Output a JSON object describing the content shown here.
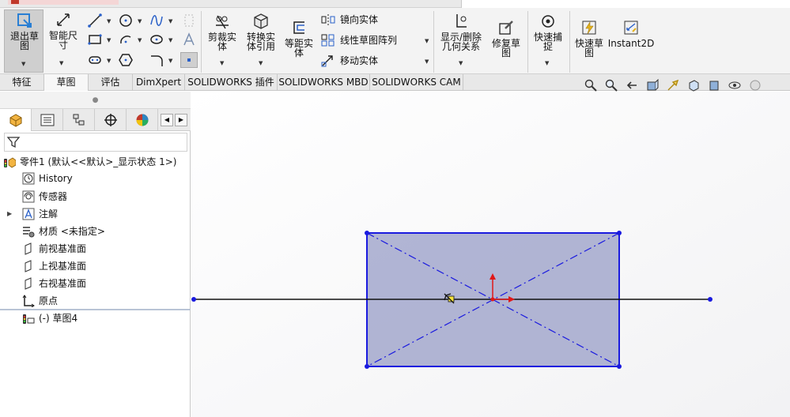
{
  "ribbon": {
    "exit_sketch": "退出草\n图",
    "smart_dimension": "智能尺\n寸",
    "trim": "剪裁实\n体",
    "convert": "转换实\n体引用",
    "offset": "等距实\n体",
    "mirror": "镜向实体",
    "linear_pattern": "线性草图阵列",
    "move": "移动实体",
    "show_delete_relations": "显示/删除\n几何关系",
    "repair_sketch": "修复草\n图",
    "quick_snaps": "快速捕\n捉",
    "rapid_sketch": "快速草\n图",
    "instant2d": "Instant2D"
  },
  "tabs": [
    {
      "label": "特征"
    },
    {
      "label": "草图"
    },
    {
      "label": "评估"
    },
    {
      "label": "DimXpert"
    },
    {
      "label": "SOLIDWORKS 插件"
    },
    {
      "label": "SOLIDWORKS MBD"
    },
    {
      "label": "SOLIDWORKS CAM"
    }
  ],
  "tree": {
    "part": "零件1  (默认<<默认>_显示状态 1>)",
    "history": "History",
    "sensors": "传感器",
    "annotations": "注解",
    "material": "材质 <未指定>",
    "front_plane": "前视基准面",
    "top_plane": "上视基准面",
    "right_plane": "右视基准面",
    "origin": "原点",
    "sketch": "(-) 草图4"
  },
  "colors": {
    "sketch_blue": "#1a1adf",
    "rect_fill": "#a3a8cc",
    "origin_red": "#e01818",
    "accent_active": "#cfcfcf"
  }
}
